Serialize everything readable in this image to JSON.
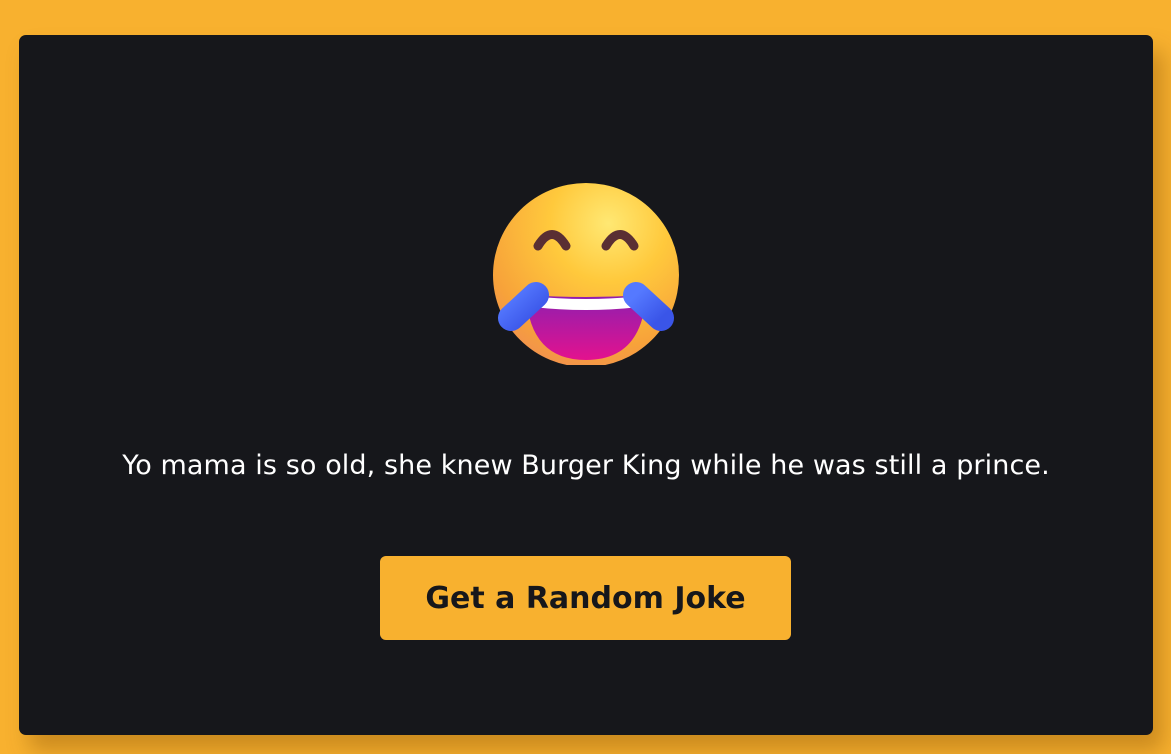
{
  "colors": {
    "background": "#f8b12f",
    "card": "#16171b",
    "text": "#ffffff",
    "button": "#f8b12f",
    "button_text": "#16171b"
  },
  "emoji": {
    "icon": "face-with-tears-of-joy-icon"
  },
  "joke": {
    "text": "Yo mama is so old, she knew Burger King while he was still a prince."
  },
  "button": {
    "label": "Get a Random Joke"
  }
}
